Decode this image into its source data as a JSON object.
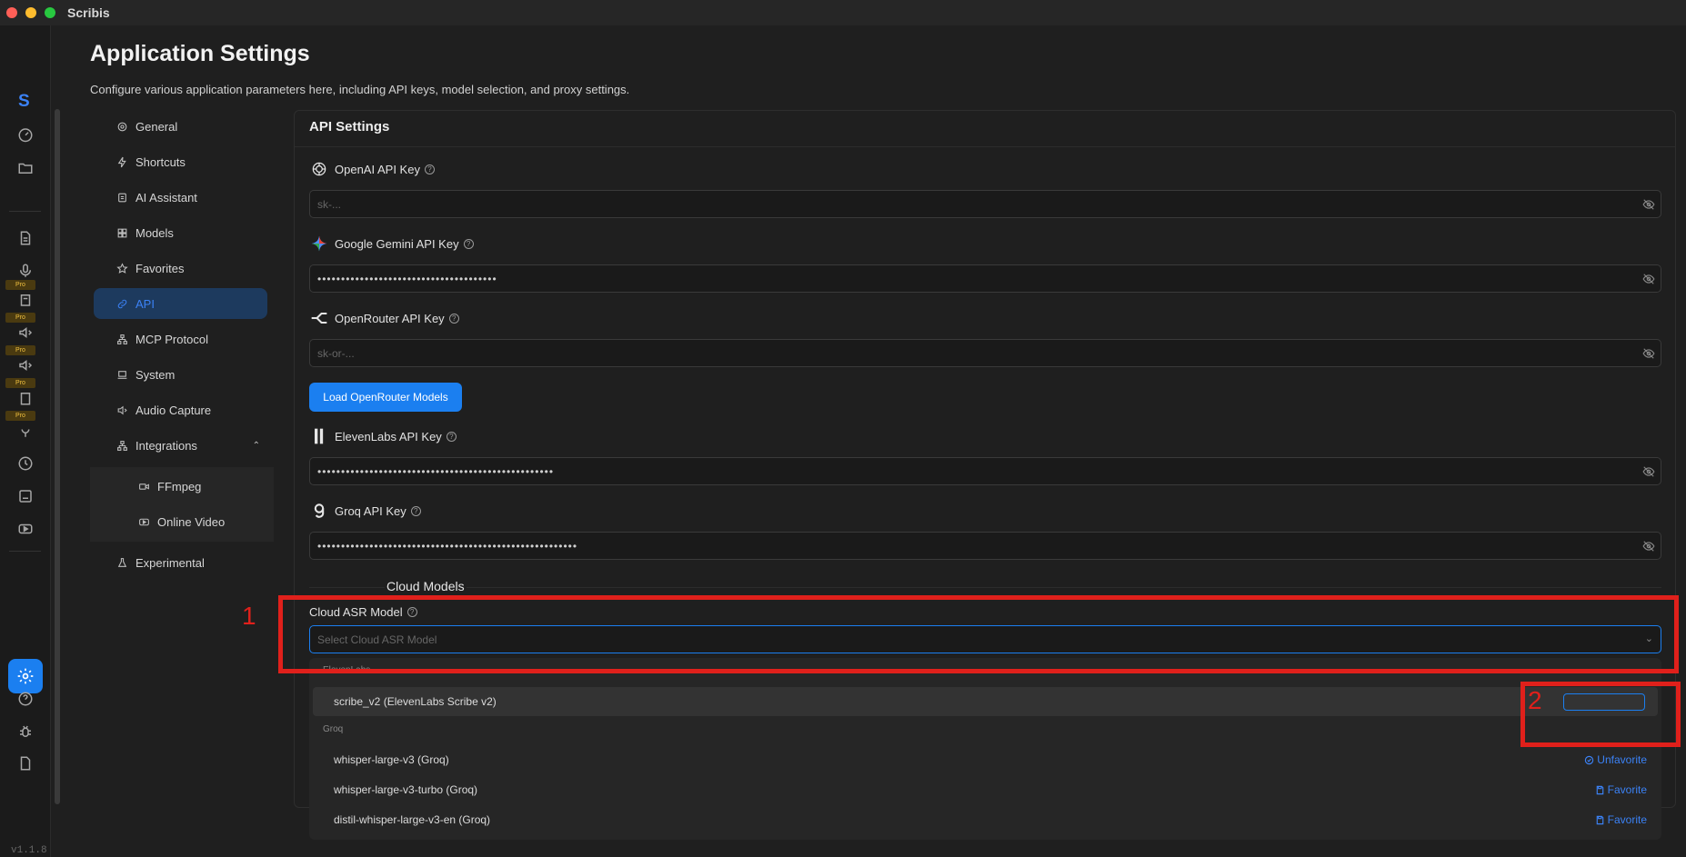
{
  "app": {
    "title": "Scribis",
    "logo_letter": "S",
    "version": "v1.1.8"
  },
  "page": {
    "title": "Application Settings",
    "description": "Configure various application parameters here, including API keys, model selection, and proxy settings."
  },
  "rail": {
    "pro_label": "Pro"
  },
  "nav": {
    "items": [
      {
        "label": "General",
        "icon": "gear-icon"
      },
      {
        "label": "Shortcuts",
        "icon": "bolt-icon"
      },
      {
        "label": "AI Assistant",
        "icon": "assistant-icon"
      },
      {
        "label": "Models",
        "icon": "grid-icon"
      },
      {
        "label": "Favorites",
        "icon": "star-icon"
      },
      {
        "label": "API",
        "icon": "link-icon",
        "active": true
      },
      {
        "label": "MCP Protocol",
        "icon": "network-icon"
      },
      {
        "label": "System",
        "icon": "laptop-icon"
      },
      {
        "label": "Audio Capture",
        "icon": "speaker-icon"
      },
      {
        "label": "Integrations",
        "icon": "integrations-icon",
        "expanded": true
      },
      {
        "label": "FFmpeg",
        "icon": "video-icon"
      },
      {
        "label": "Online Video",
        "icon": "play-icon"
      },
      {
        "label": "Experimental",
        "icon": "flask-icon"
      }
    ]
  },
  "api": {
    "heading": "API Settings",
    "openai": {
      "label": "OpenAI API Key",
      "placeholder": "sk-..."
    },
    "gemini": {
      "label": "Google Gemini API Key",
      "value": "••••••••••••••••••••••••••••••••••••••"
    },
    "openrouter": {
      "label": "OpenRouter API Key",
      "placeholder": "sk-or-..."
    },
    "load_button": "Load OpenRouter Models",
    "elevenlabs": {
      "label": "ElevenLabs API Key",
      "value": "••••••••••••••••••••••••••••••••••••••••••••••••••"
    },
    "groq": {
      "label": "Groq API Key",
      "value": "•••••••••••••••••••••••••••••••••••••••••••••••••••••••"
    }
  },
  "cloud": {
    "section_title": "Cloud Models",
    "asr_label": "Cloud ASR Model",
    "asr_placeholder": "Select Cloud ASR Model",
    "groups": {
      "elevenlabs": "ElevenLabs",
      "groq": "Groq"
    },
    "options": [
      {
        "label": "scribe_v2 (ElevenLabs Scribe v2)",
        "action": ""
      },
      {
        "label": "whisper-large-v3 (Groq)",
        "action": "Unfavorite"
      },
      {
        "label": "whisper-large-v3-turbo (Groq)",
        "action": "Favorite"
      },
      {
        "label": "distil-whisper-large-v3-en (Groq)",
        "action": "Favorite"
      }
    ]
  },
  "annotations": {
    "box1": "1",
    "box2": "2"
  },
  "colors": {
    "accent": "#1b7ff0",
    "annotation": "#e0201b",
    "background": "#1f1f1f"
  }
}
